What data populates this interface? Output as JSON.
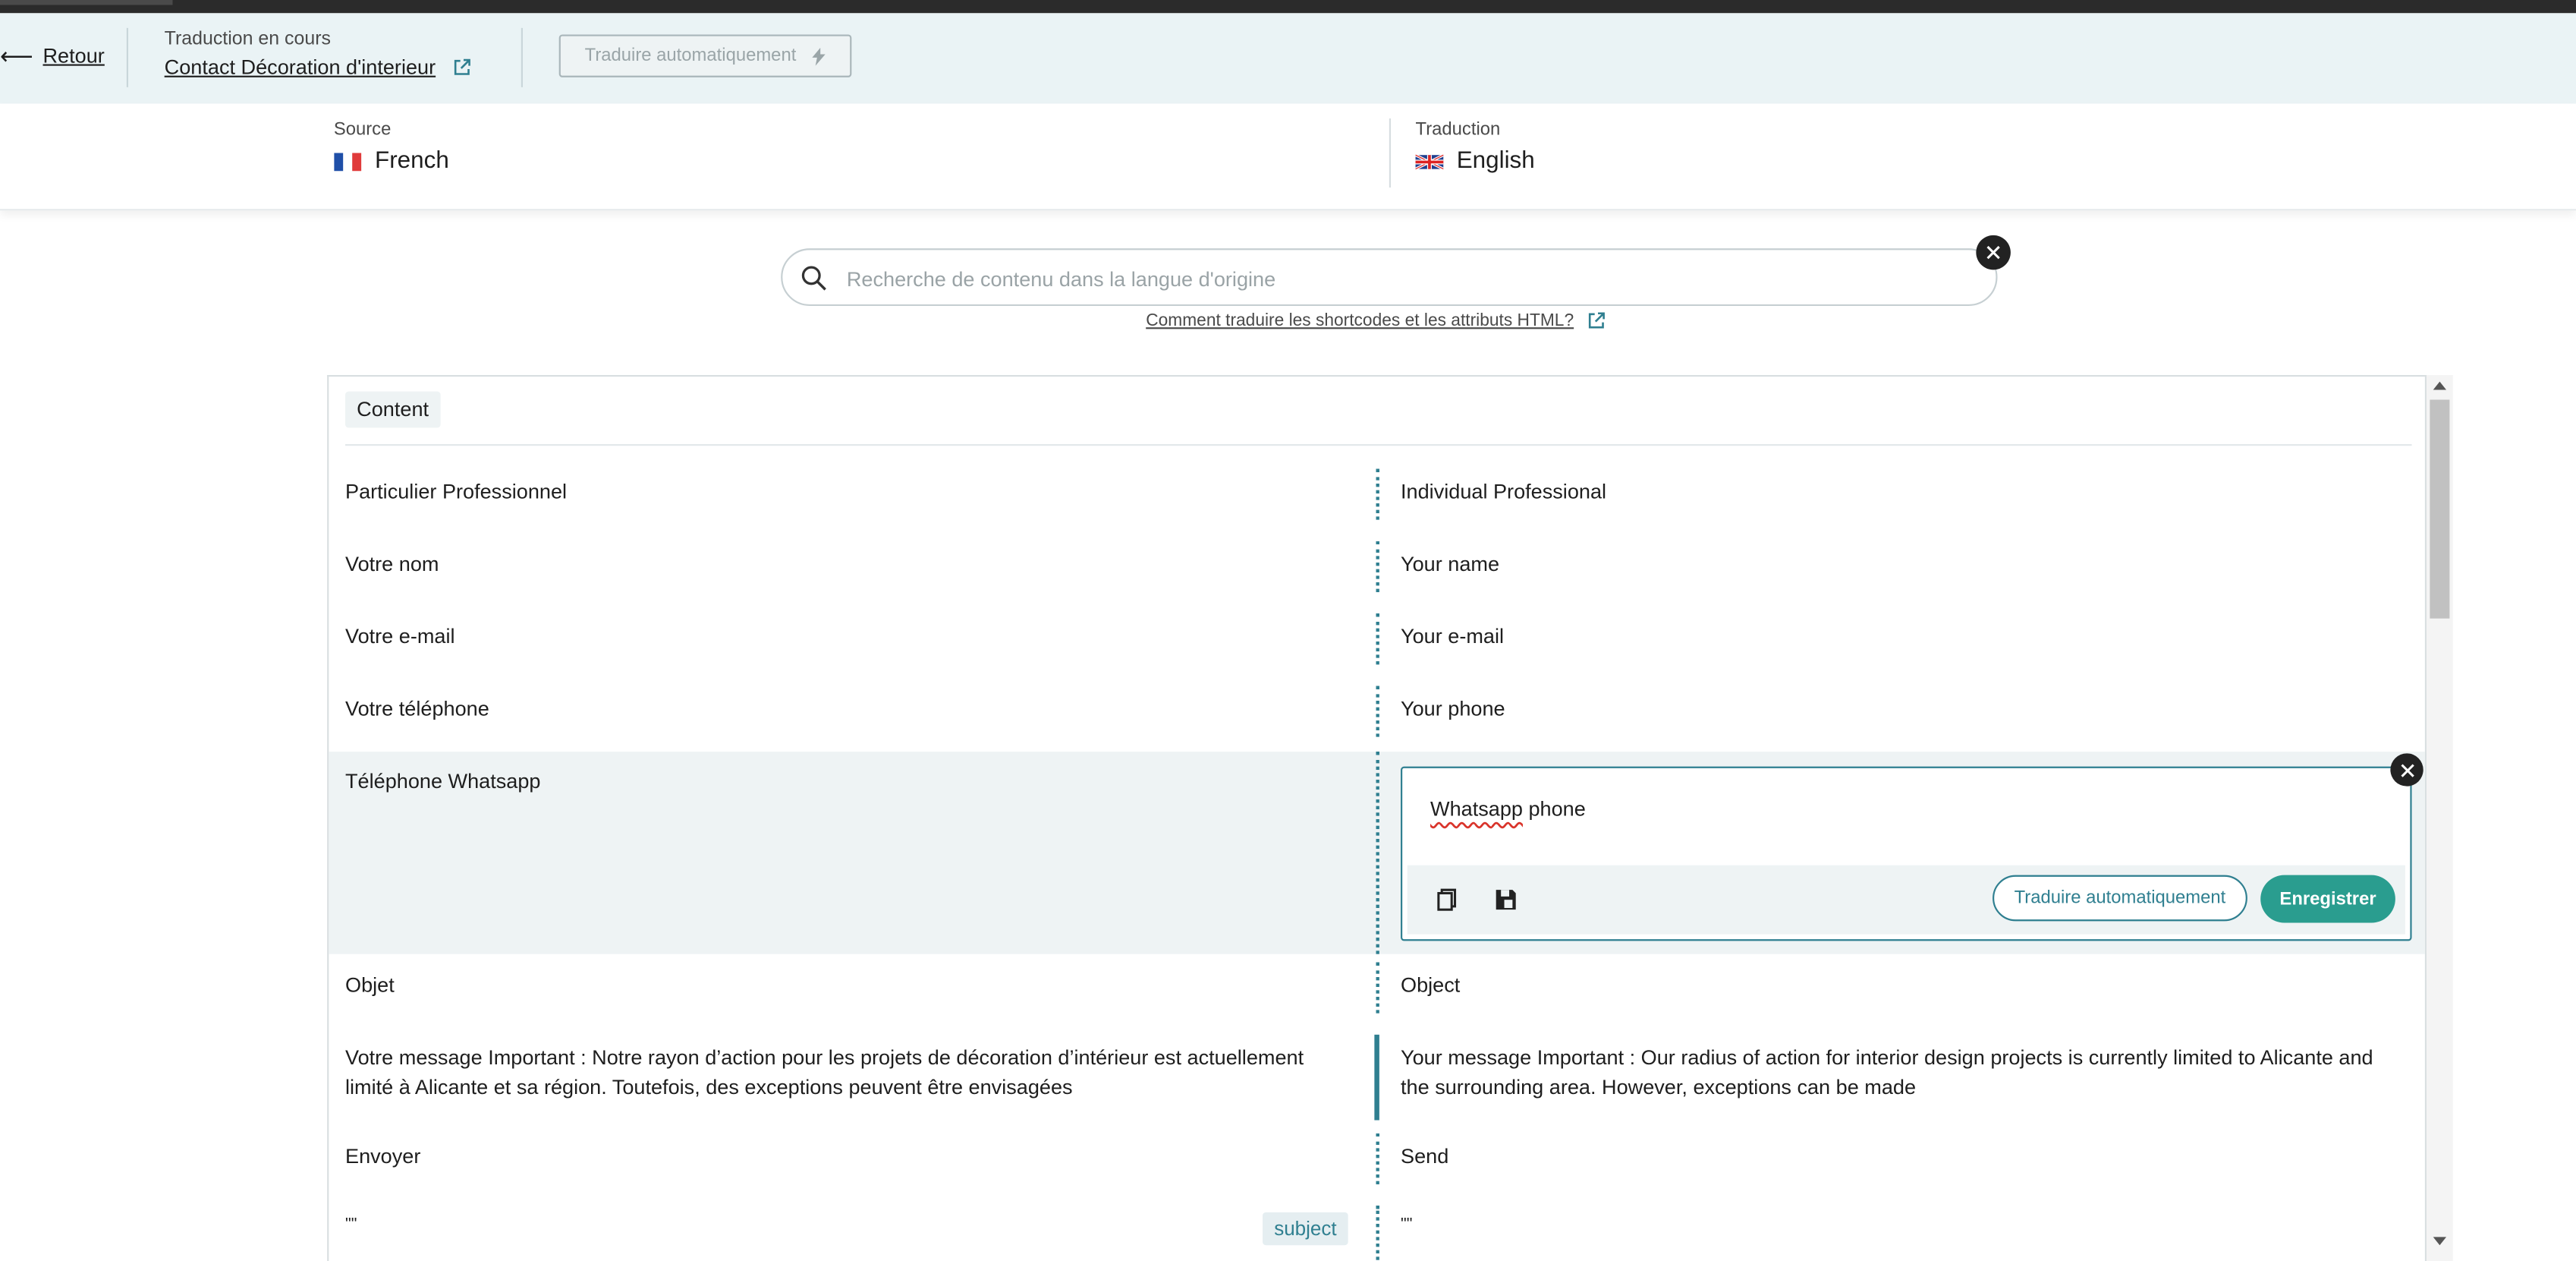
{
  "header": {
    "back_label": "Retour",
    "status_caption": "Traduction en cours",
    "page_title": "Contact Décoration d'interieur",
    "auto_translate_label": "Traduire automatiquement"
  },
  "languages": {
    "source_caption": "Source",
    "source_name": "French",
    "target_caption": "Traduction",
    "target_name": "English"
  },
  "search": {
    "placeholder": "Recherche de contenu dans la langue d'origine",
    "help_link": "Comment traduire les shortcodes et les attributs HTML?"
  },
  "section": {
    "label": "Content"
  },
  "rows": [
    {
      "source": "Particulier Professionnel",
      "target": "Individual Professional"
    },
    {
      "source": "Votre nom",
      "target": "Your name"
    },
    {
      "source": "Votre e-mail",
      "target": "Your e-mail"
    },
    {
      "source": "Votre téléphone",
      "target": "Your phone"
    },
    {
      "source": "Téléphone Whatsapp",
      "target": "Whatsapp phone"
    },
    {
      "source": "Objet",
      "target": "Object"
    },
    {
      "source": "Votre message Important : Notre rayon d’action pour les projets de décoration d’intérieur est actuellement limité à Alicante et sa région. Toutefois, des exceptions peuvent être envisagées",
      "target": "Your message Important : Our radius of action for interior design projects is currently limited to Alicante and the surrounding area. However, exceptions can be made"
    },
    {
      "source": "Envoyer",
      "target": "Send"
    },
    {
      "source": "\"\"",
      "target": "\"\"",
      "tag": "subject"
    }
  ],
  "editor": {
    "value_word1": "Whatsapp",
    "value_rest": " phone",
    "auto_translate_label": "Traduire automatiquement",
    "save_label": "Enregistrer"
  },
  "colors": {
    "accent": "#2f7f90",
    "primary_button": "#2a9d8f",
    "header_bg": "#eaf3f5",
    "active_row_bg": "#eef3f4",
    "spellcheck": "#d9342b"
  },
  "icons": [
    "back-arrow-icon",
    "external-link-icon",
    "bolt-icon",
    "france-flag-icon",
    "uk-flag-icon",
    "search-icon",
    "close-icon",
    "copy-icon",
    "save-memory-icon"
  ]
}
